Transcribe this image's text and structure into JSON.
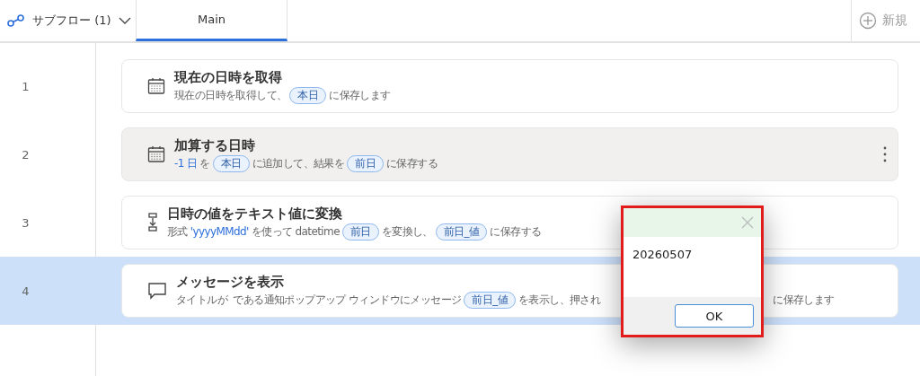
{
  "header": {
    "subflows": {
      "label": "サブフロー (1)"
    },
    "tabs": [
      {
        "label": "Main",
        "selected": true
      }
    ],
    "new_button": {
      "label": "新規"
    }
  },
  "steps": [
    {
      "number": "1",
      "kind": "calendar",
      "title": "現在の日時を取得",
      "hovered": false,
      "selected": false,
      "description": [
        {
          "kind": "text",
          "text": "現在の日時を取得して、"
        },
        {
          "kind": "var",
          "text": "本日"
        },
        {
          "kind": "text",
          "text": "に保存します"
        }
      ]
    },
    {
      "number": "2",
      "kind": "calendar",
      "title": "加算する日時",
      "hovered": true,
      "selected": false,
      "description": [
        {
          "kind": "value",
          "text": "-1 日"
        },
        {
          "kind": "text",
          "text": "を"
        },
        {
          "kind": "var",
          "text": "本日"
        },
        {
          "kind": "text",
          "text": "に追加して、結果を"
        },
        {
          "kind": "var",
          "text": "前日"
        },
        {
          "kind": "text",
          "text": "に保存する"
        }
      ]
    },
    {
      "number": "3",
      "kind": "convert",
      "title": "日時の値をテキスト値に変換",
      "hovered": false,
      "selected": false,
      "description": [
        {
          "kind": "text",
          "text": "形式"
        },
        {
          "kind": "value",
          "text": "'yyyyMMdd'"
        },
        {
          "kind": "text",
          "text": "を使って datetime"
        },
        {
          "kind": "var",
          "text": "前日"
        },
        {
          "kind": "text",
          "text": "を変換し、"
        },
        {
          "kind": "var",
          "text": "前日_値"
        },
        {
          "kind": "text",
          "text": "に保存する"
        }
      ]
    },
    {
      "number": "4",
      "kind": "message",
      "title": "メッセージを表示",
      "hovered": false,
      "selected": true,
      "description": [
        {
          "kind": "text",
          "text": "タイトルが  である通知ポップアップ ウィンドウにメッセージ"
        },
        {
          "kind": "var",
          "text": "前日_値"
        },
        {
          "kind": "text",
          "text": "を表示し、押され"
        },
        {
          "kind": "gap"
        },
        {
          "kind": "text",
          "text": "に保存します"
        }
      ]
    }
  ],
  "dialog": {
    "message": "20260507",
    "button": "OK"
  }
}
